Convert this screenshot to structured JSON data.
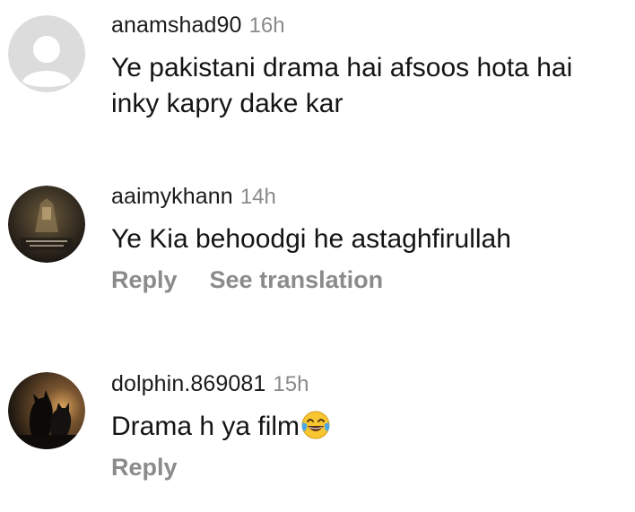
{
  "comments": [
    {
      "username": "anamshad90",
      "time": "16h",
      "text": "Ye pakistani drama hai afsoos hota hai inky kapry dake kar",
      "avatar": "default-avatar-icon"
    },
    {
      "username": "aaimykhann",
      "time": "14h",
      "text": "Ye Kia behoodgi he astaghfirullah",
      "reply_label": "Reply",
      "translate_label": "See translation",
      "avatar": "profile-photo"
    },
    {
      "username": "dolphin.869081",
      "time": "15h",
      "text": "Drama h ya film",
      "emoji": "tears-of-joy-emoji",
      "reply_label": "Reply",
      "avatar": "profile-photo-cats"
    }
  ],
  "colors": {
    "username": "#1b1b1b",
    "time": "#8a8a8a",
    "action": "#8b8b8b",
    "text": "#141414",
    "default_avatar_bg": "#dcdcdc"
  }
}
